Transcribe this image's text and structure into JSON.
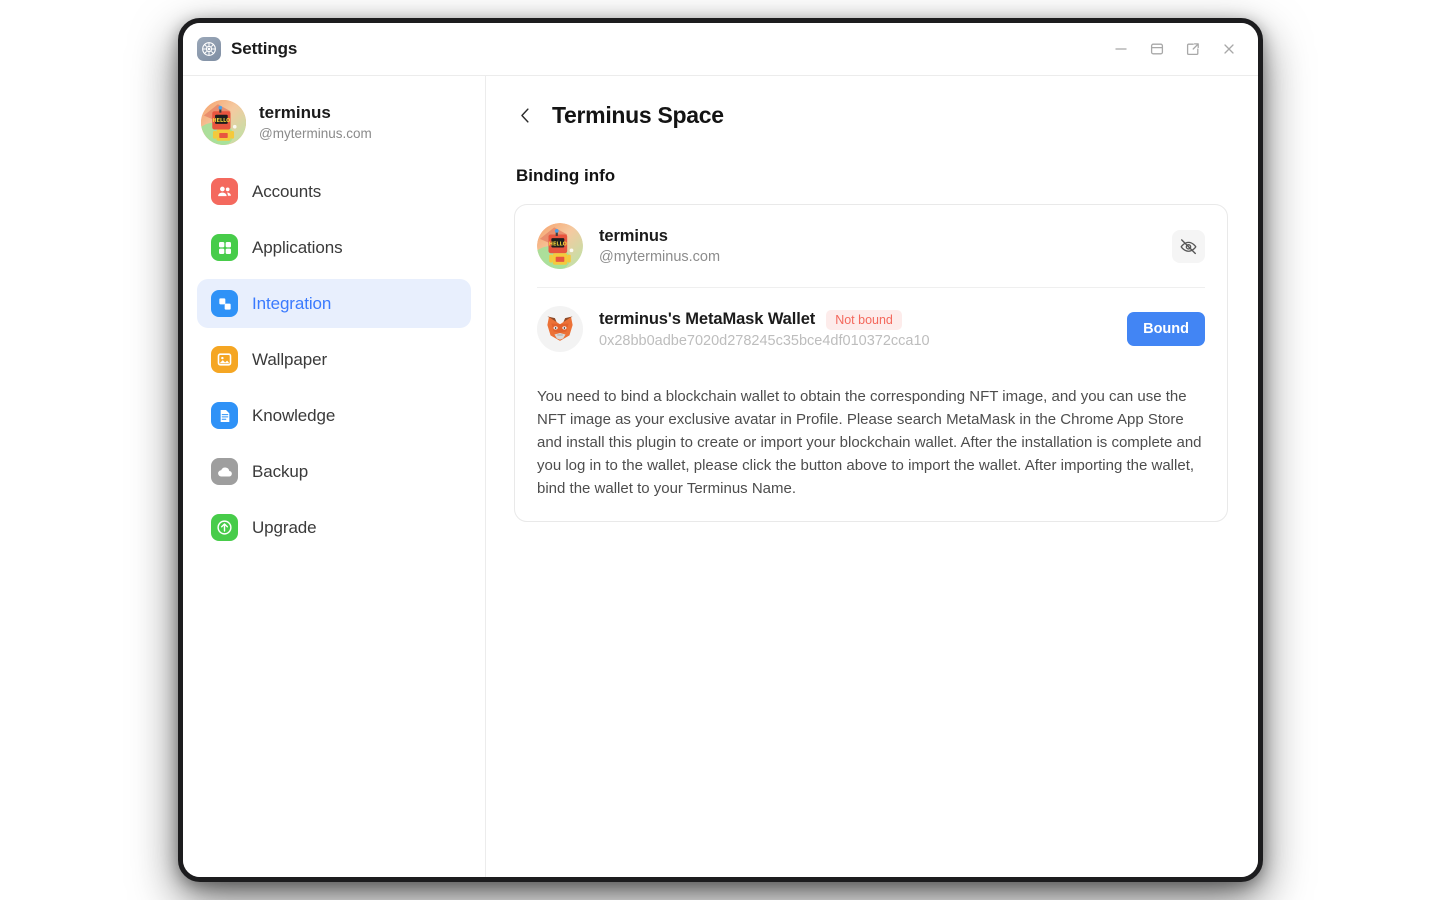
{
  "window": {
    "app_icon": "settings-gear-icon",
    "title": "Settings",
    "controls": [
      {
        "name": "minimize-button",
        "icon": "minimize-icon"
      },
      {
        "name": "restore-button",
        "icon": "window-restore-icon"
      },
      {
        "name": "popout-button",
        "icon": "external-link-icon"
      },
      {
        "name": "close-button",
        "icon": "close-icon"
      }
    ]
  },
  "sidebar": {
    "profile": {
      "name": "terminus",
      "handle": "@myterminus.com",
      "avatar": "nft-robot-avatar"
    },
    "items": [
      {
        "label": "Accounts",
        "icon": "accounts-icon",
        "color": "#f4695e",
        "active": false
      },
      {
        "label": "Applications",
        "icon": "applications-icon",
        "color": "#47cc4a",
        "active": false
      },
      {
        "label": "Integration",
        "icon": "integration-icon",
        "color": "#2f92f7",
        "active": true
      },
      {
        "label": "Wallpaper",
        "icon": "wallpaper-icon",
        "color": "#f5a623",
        "active": false
      },
      {
        "label": "Knowledge",
        "icon": "knowledge-icon",
        "color": "#2f92f7",
        "active": false
      },
      {
        "label": "Backup",
        "icon": "backup-icon",
        "color": "#9e9e9e",
        "active": false
      },
      {
        "label": "Upgrade",
        "icon": "upgrade-icon",
        "color": "#47cc4a",
        "active": false
      }
    ],
    "active_color": "#3a7afe",
    "active_bg": "#e8effd"
  },
  "main": {
    "back_icon": "chevron-left-icon",
    "page_title": "Terminus Space",
    "section_title": "Binding info",
    "account_row": {
      "avatar": "nft-robot-avatar",
      "name": "terminus",
      "handle": "@myterminus.com",
      "action_icon": "eye-off-icon"
    },
    "wallet_row": {
      "avatar": "metamask-fox-icon",
      "name": "terminus's MetaMask Wallet",
      "badge": "Not bound",
      "badge_color": "#f4685c",
      "badge_bg": "#fdeceb",
      "address": "0x28bb0adbe7020d278245c35bce4df010372cca10",
      "button_label": "Bound",
      "button_color": "#4285f4"
    },
    "description": "You need to bind a blockchain wallet to obtain the corresponding NFT image, and you can use the NFT image as your exclusive avatar in Profile. Please search MetaMask in the Chrome App Store and install this plugin to create or import your blockchain wallet. After the installation is complete and you log in to the wallet, please click the button above to import the wallet. After importing the wallet, bind the wallet to your Terminus Name."
  }
}
